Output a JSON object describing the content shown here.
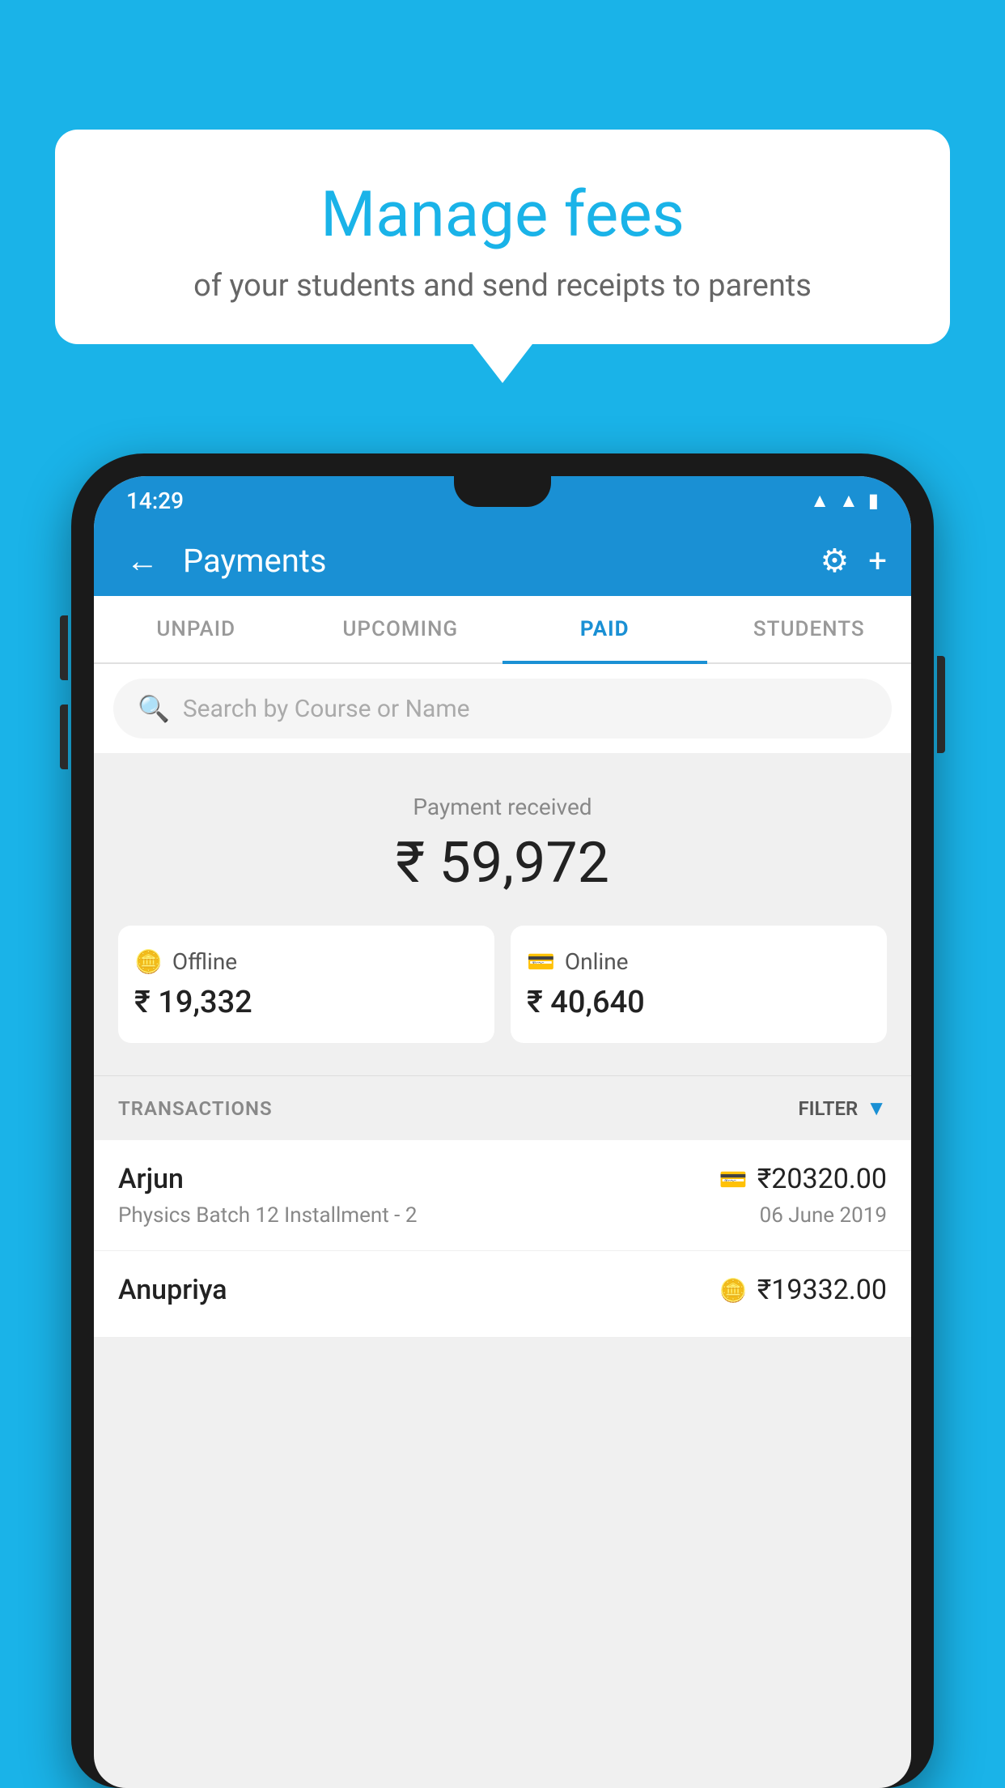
{
  "page": {
    "background_color": "#1ab3e8"
  },
  "speech_bubble": {
    "title": "Manage fees",
    "subtitle": "of your students and send receipts to parents"
  },
  "status_bar": {
    "time": "14:29",
    "wifi_icon": "wifi",
    "signal_icon": "signal",
    "battery_icon": "battery"
  },
  "app_bar": {
    "title": "Payments",
    "back_label": "←",
    "settings_icon": "gear",
    "add_icon": "+"
  },
  "tabs": [
    {
      "label": "UNPAID",
      "active": false
    },
    {
      "label": "UPCOMING",
      "active": false
    },
    {
      "label": "PAID",
      "active": true
    },
    {
      "label": "STUDENTS",
      "active": false
    }
  ],
  "search": {
    "placeholder": "Search by Course or Name"
  },
  "payment_received": {
    "label": "Payment received",
    "total": "₹ 59,972",
    "offline": {
      "label": "Offline",
      "amount": "₹ 19,332"
    },
    "online": {
      "label": "Online",
      "amount": "₹ 40,640"
    }
  },
  "transactions": {
    "header": "TRANSACTIONS",
    "filter_label": "FILTER",
    "rows": [
      {
        "name": "Arjun",
        "description": "Physics Batch 12 Installment - 2",
        "amount": "₹20320.00",
        "date": "06 June 2019",
        "icon_type": "card"
      },
      {
        "name": "Anupriya",
        "description": "",
        "amount": "₹19332.00",
        "date": "",
        "icon_type": "cash"
      }
    ]
  }
}
